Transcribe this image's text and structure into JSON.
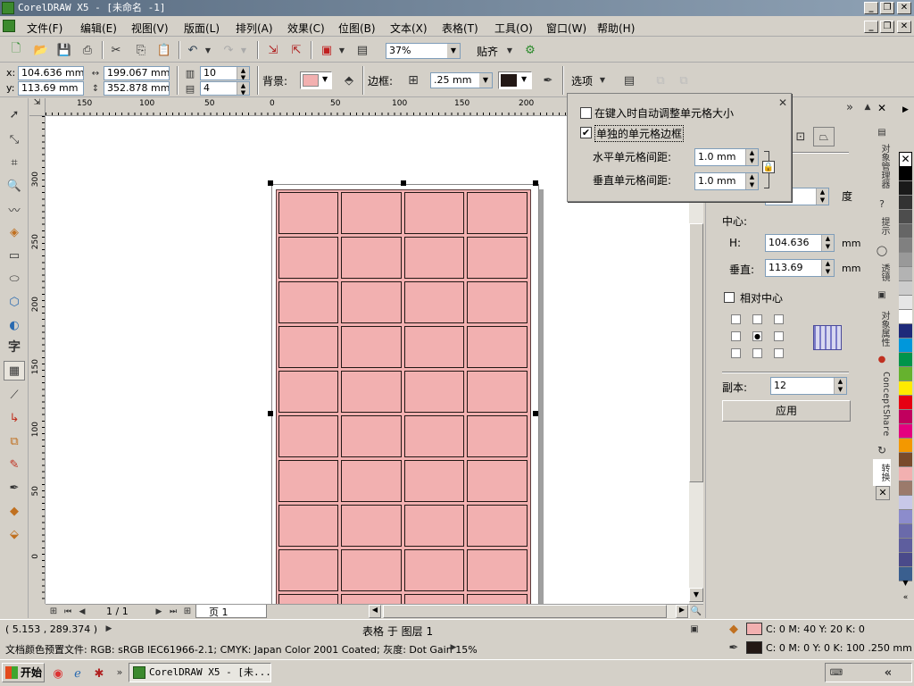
{
  "titlebar": {
    "title": "CorelDRAW X5 - [未命名 -1]"
  },
  "menu": {
    "items": [
      "文件(F)",
      "编辑(E)",
      "视图(V)",
      "版面(L)",
      "排列(A)",
      "效果(C)",
      "位图(B)",
      "文本(X)",
      "表格(T)",
      "工具(O)",
      "窗口(W)",
      "帮助(H)"
    ]
  },
  "toolbar": {
    "zoom": "37%",
    "snap_label": "贴齐"
  },
  "propbar": {
    "x_label": "x:",
    "x": "104.636 mm",
    "y_label": "y:",
    "y": "113.69 mm",
    "w": "199.067 mm",
    "h": "352.878 mm",
    "rows": "10",
    "cols": "4",
    "background_label": "背景:",
    "border_label": "边框:",
    "border_width": ".25 mm",
    "options_label": "选项"
  },
  "options_popup": {
    "auto_resize_label": "在键入时自动调整单元格大小",
    "separate_borders_label": "单独的单元格边框",
    "h_spacing_label": "水平单元格间距:",
    "h_spacing": "1.0 mm",
    "v_spacing_label": "垂直单元格间距:",
    "v_spacing": "1.0 mm"
  },
  "ruler": {
    "h_ticks": [
      "150",
      "100",
      "50",
      "0",
      "50",
      "100",
      "150",
      "200"
    ],
    "v_ticks": [
      "300",
      "250",
      "200",
      "150",
      "100",
      "50",
      "0"
    ]
  },
  "docker": {
    "degree_label": "度",
    "center_label": "中心:",
    "h_label": "H:",
    "h_value": "104.636",
    "v_label": "垂直:",
    "v_value": "113.69",
    "unit": "mm",
    "relative_center_label": "相对中心",
    "copies_label": "副本:",
    "copies_value": "12",
    "apply_label": "应用",
    "tabs": [
      "对象管理器",
      "提示",
      "透镜",
      "对象属性",
      "ConceptShare",
      "转换"
    ]
  },
  "pagenav": {
    "counter": "1 / 1",
    "page_tab": "页 1"
  },
  "status": {
    "coords": "( 5.153 , 289.374 )",
    "object_info": "表格 于 图层 1",
    "fill_info": "C: 0 M: 40 Y: 20 K: 0",
    "outline_info": "C: 0 M: 0 Y: 0 K: 100  .250 mm",
    "profile": "文档颜色预置文件: RGB: sRGB IEC61966-2.1; CMYK: Japan Color 2001 Coated; 灰度: Dot Gain 15%"
  },
  "taskbar": {
    "start_label": "开始",
    "task_label": "CorelDRAW X5 - [未...",
    "chevron": "«"
  },
  "colors": {
    "fill": "#f2b0b0",
    "outline": "#231815",
    "titlebar": "#0a246a"
  },
  "palette": [
    "#ffffff",
    "#000000",
    "#1a1a1a",
    "#333333",
    "#4d4d4d",
    "#666666",
    "#808080",
    "#999999",
    "#b3b3b3",
    "#cccccc",
    "#e6e6e6",
    "#ffffff",
    "#1e2a7a",
    "#0097db",
    "#00944a",
    "#66b22e",
    "#ffea00",
    "#e60012",
    "#c1005e",
    "#e4007f",
    "#f39800",
    "#7a4b2b",
    "#f2b0b0",
    "#9b7a6b",
    "#c8c8e8",
    "#8c8ccc",
    "#6a6aaa",
    "#5e5e9e",
    "#4a4a8a",
    "#3a5f8f"
  ]
}
